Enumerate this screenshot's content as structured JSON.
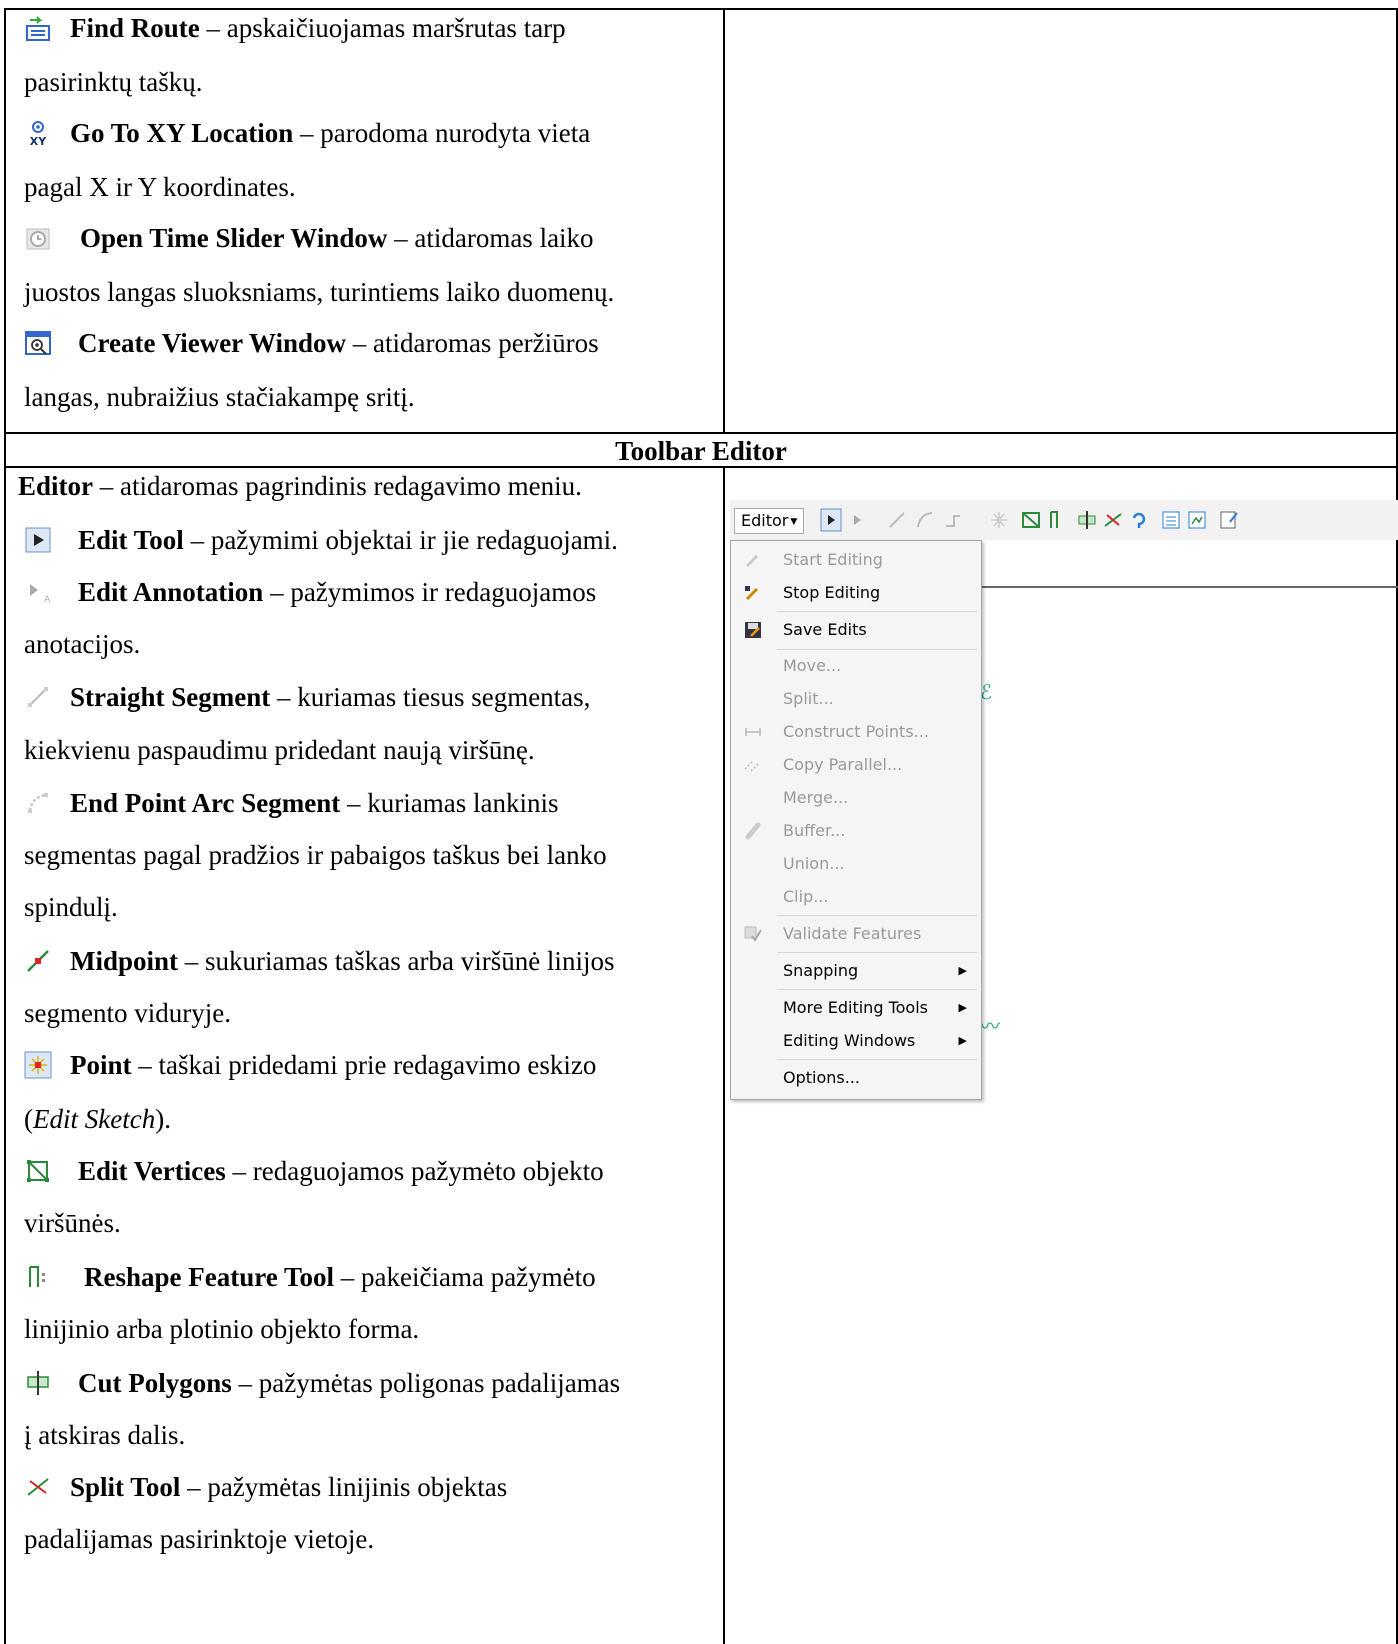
{
  "top_entries": [
    {
      "name": "Find Route",
      "rest1": " – apskaičiuojamas maršrutas tarp",
      "rest2": "pasirinktų taškų."
    },
    {
      "name": "Go To XY Location",
      "rest1": " – parodoma nurodyta vieta",
      "rest2": "pagal X ir Y koordinates."
    },
    {
      "name": "Open Time Slider Window",
      "rest1": " – atidaromas laiko",
      "rest2": "juostos langas sluoksniams, turintiems laiko duomenų."
    },
    {
      "name": "Create Viewer Window",
      "rest1": " – atidaromas peržiūros",
      "rest2": "langas, nubraižius stačiakampę sritį."
    }
  ],
  "section_title": "Toolbar Editor",
  "editor_intro": {
    "name": "Editor",
    "rest": " – atidaromas pagrindinis redagavimo meniu."
  },
  "editor_entries": [
    {
      "name": "Edit Tool",
      "line1": " – pažymimi objektai ir jie redaguojami."
    },
    {
      "name": "Edit Annotation",
      "line1": " – pažymimos ir redaguojamos",
      "line2": "anotacijos."
    },
    {
      "name": "Straight Segment",
      "line1": " – kuriamas tiesus segmentas,",
      "line2": "kiekvienu paspaudimu pridedant naują viršūnę."
    },
    {
      "name": "End Point Arc Segment",
      "line1": " – kuriamas lankinis",
      "line2": "segmentas pagal pradžios ir pabaigos taškus bei lanko",
      "line3": "spindulį."
    },
    {
      "name": "Midpoint",
      "line1": " – sukuriamas taškas arba viršūnė linijos",
      "line2": "segmento viduryje."
    },
    {
      "name": "Point",
      "line1": " – taškai pridedami prie redagavimo eskizo",
      "line2_open": "(",
      "line2_italic": "Edit Sketch",
      "line2_close": ")."
    },
    {
      "name": "Edit Vertices",
      "line1": " – redaguojamos pažymėto objekto",
      "line2": "viršūnės."
    },
    {
      "name": "Reshape Feature Tool",
      "line1": " – pakeičiama pažymėto",
      "line2": "linijinio arba plotinio objekto forma."
    },
    {
      "name": "Cut Polygons",
      "line1": " – pažymėtas poligonas padalijamas",
      "line2": "į atskiras dalis."
    },
    {
      "name": "Split Tool",
      "line1": " – pažymėtas linijinis objektas",
      "line2": "padalijamas pasirinktoje vietoje."
    }
  ],
  "editor_screenshot": {
    "button_label": "Editor",
    "menu": [
      {
        "label": "Start Editing",
        "enabled": false
      },
      {
        "label": "Stop Editing",
        "enabled": true
      },
      {
        "label": "Save Edits",
        "enabled": true
      },
      {
        "label": "Move...",
        "enabled": false
      },
      {
        "label": "Split...",
        "enabled": false
      },
      {
        "label": "Construct Points...",
        "enabled": false
      },
      {
        "label": "Copy Parallel...",
        "enabled": false
      },
      {
        "label": "Merge...",
        "enabled": false
      },
      {
        "label": "Buffer...",
        "enabled": false
      },
      {
        "label": "Union...",
        "enabled": false
      },
      {
        "label": "Clip...",
        "enabled": false
      },
      {
        "label": "Validate Features",
        "enabled": false
      },
      {
        "label": "Snapping",
        "enabled": true,
        "submenu": true
      },
      {
        "label": "More Editing Tools",
        "enabled": true,
        "submenu": true
      },
      {
        "label": "Editing Windows",
        "enabled": true,
        "submenu": true
      },
      {
        "label": "Options...",
        "enabled": true
      }
    ]
  }
}
